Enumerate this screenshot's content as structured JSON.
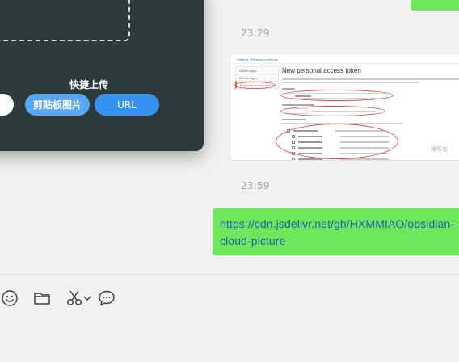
{
  "chat": {
    "timestamp_1": "23:29",
    "timestamp_2": "23:59",
    "image_message": {
      "breadcrumb": "Settings / Developer settings",
      "title": "New personal access token",
      "nav_items": [
        "OAuth Apps",
        "GitHub Apps",
        "Personal access tokens"
      ],
      "watermark": "稀客笔"
    },
    "link_message": {
      "line_1": "https://cdn.jsdelivr.net/gh/HXMMIAO/obsidian-",
      "line_2": "cloud-picture"
    },
    "colors": {
      "bubble_green": "#6ee85a",
      "link_blue": "#1f5fb4",
      "oval_red": "#e24a4a"
    }
  },
  "toolbar": {
    "icons": [
      "emoji-icon",
      "folder-icon",
      "scissors-icon",
      "chevron-down-icon",
      "chat-bubble-icon"
    ]
  },
  "upload_panel": {
    "section_title": "快捷上传",
    "buttons": {
      "clipboard_label": "剪贴板图片",
      "url_label": "URL"
    },
    "colors": {
      "panel_bg": "#2b3a3b",
      "clipboard_btn": "#58a7f4",
      "url_btn": "#3592f0"
    }
  }
}
